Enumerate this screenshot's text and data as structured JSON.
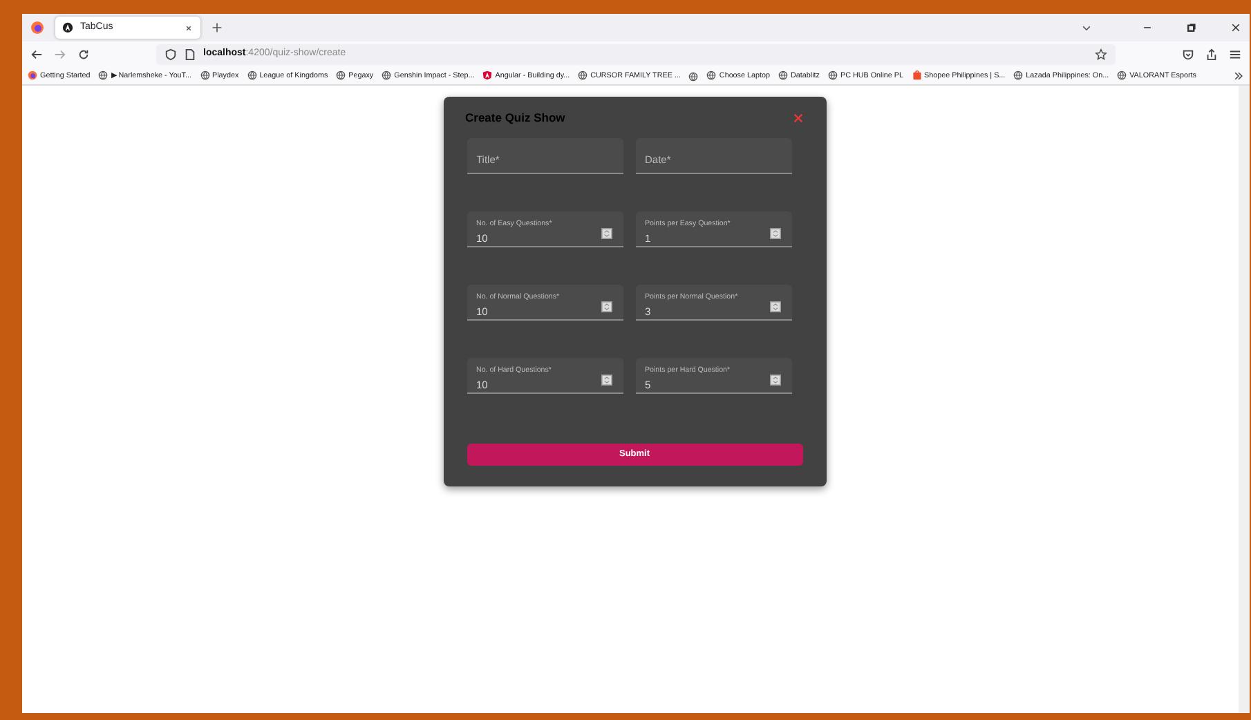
{
  "browser": {
    "tabs": [
      {
        "title": "TabCus",
        "selected": true
      }
    ],
    "url_host": "localhost",
    "url_path": ":4200/quiz-show/create",
    "bookmarks": [
      {
        "label": "Getting Started",
        "kind": "firefox"
      },
      {
        "label": "▶ Narlemsheke - YouT...",
        "kind": "globe"
      },
      {
        "label": "Playdex",
        "kind": "globe"
      },
      {
        "label": "League of Kingdoms",
        "kind": "globe"
      },
      {
        "label": "Pegaxy",
        "kind": "globe"
      },
      {
        "label": "Genshin Impact - Step...",
        "kind": "globe"
      },
      {
        "label": "Angular - Building dy...",
        "kind": "angular"
      },
      {
        "label": "CURSOR FAMILY TREE ...",
        "kind": "globe"
      },
      {
        "kind": "globe"
      },
      {
        "label": "Choose Laptop",
        "kind": "globe"
      },
      {
        "label": "Datablitz",
        "kind": "globe"
      },
      {
        "label": "PC HUB Online PL",
        "kind": "globe"
      },
      {
        "label": "Shopee Philippines | S...",
        "kind": "shop"
      },
      {
        "label": "Lazada Philippines: On...",
        "kind": "globe"
      },
      {
        "label": "VALORANT Esports",
        "kind": "globe"
      }
    ]
  },
  "dialog": {
    "title": "Create Quiz Show",
    "fields": [
      {
        "placeholder": "Title*",
        "kind": "text"
      },
      {
        "placeholder": "Date*",
        "kind": "text"
      },
      {
        "label": "No. of Easy Questions*",
        "value": "10",
        "kind": "number"
      },
      {
        "label": "Points per Easy Question*",
        "value": "1",
        "kind": "number"
      },
      {
        "label": "No. of Normal Questions*",
        "value": "10",
        "kind": "number"
      },
      {
        "label": "Points per Normal Question*",
        "value": "3",
        "kind": "number"
      },
      {
        "label": "No. of Hard Questions*",
        "value": "10",
        "kind": "number"
      },
      {
        "label": "Points per Hard Question*",
        "value": "5",
        "kind": "number"
      }
    ],
    "submit": "Submit"
  }
}
